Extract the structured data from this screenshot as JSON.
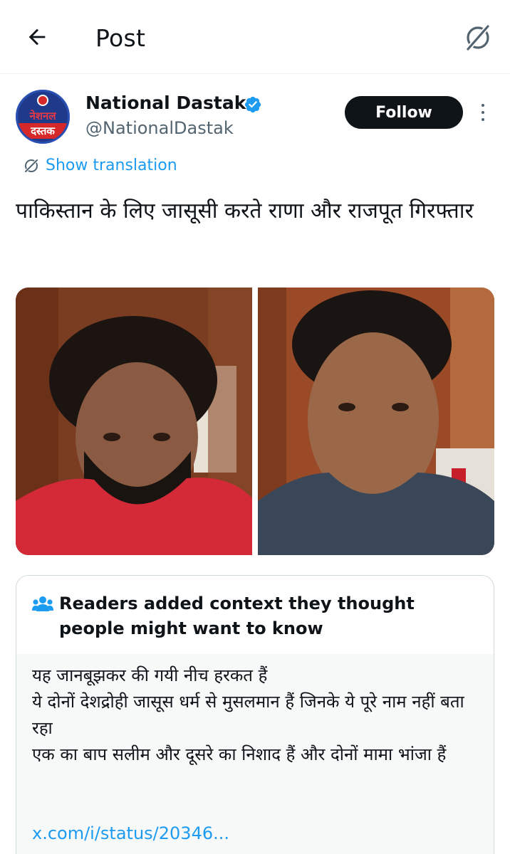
{
  "topbar": {
    "title": "Post",
    "back_icon": "arrow-left-icon",
    "grok_icon": "grok-icon"
  },
  "author": {
    "name": "National Dastak",
    "handle": "@NationalDastak",
    "avatar_line1": "नेशनल",
    "avatar_line2": "दस्तक",
    "verified_icon": "verified-badge-icon"
  },
  "actions": {
    "follow_label": "Follow"
  },
  "translation": {
    "label": "Show translation"
  },
  "post": {
    "text": "पाकिस्तान के लिए जासूसी करते राणा और राजपूत गिरफ्तार"
  },
  "note": {
    "title": "Readers added context they thought people might want to know",
    "body": "यह जानबूझकर की गयी नीच हरकत हैं\nये दोनों देशद्रोही जासूस धर्म से मुसलमान हैं जिनके ये पूरे नाम नहीं बता रहा\nएक का बाप सलीम और दूसरे का निशाद हैं और दोनों मामा भांजा हैं",
    "link": "x.com/i/status/20346..."
  },
  "colors": {
    "accent": "#1d9bf0",
    "text": "#0f1419",
    "secondary": "#536471",
    "follow_bg": "#0f1419"
  }
}
